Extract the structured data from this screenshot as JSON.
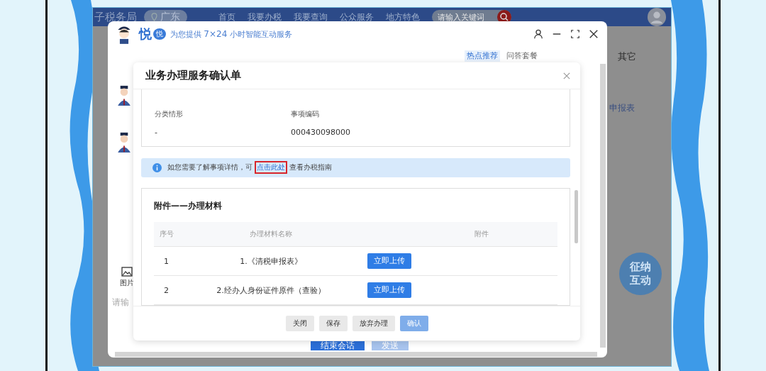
{
  "portal": {
    "site_title": "子税务局",
    "region": "广东",
    "nav": [
      {
        "label": "首页"
      },
      {
        "label": "我要办税"
      },
      {
        "label": "我要查询"
      },
      {
        "label": "公众服务"
      },
      {
        "label": "地方特色"
      }
    ],
    "search": {
      "placeholder": "请输入关键词"
    },
    "side_tab": "其它",
    "side_link": "申报表",
    "float_button": "征纳互动"
  },
  "chat_window": {
    "brand": "悦",
    "badge": "悦",
    "tagline_prefix": "为您提供 ",
    "tagline_hours": "7×24",
    "tagline_suffix": " 小时智能互动服务",
    "tabs": [
      {
        "label": "热点推荐",
        "selected": true
      },
      {
        "label": "问答套餐",
        "selected": false
      }
    ],
    "tool": "图片",
    "input": {
      "placeholder": "请输"
    },
    "buttons": [
      {
        "label": "结束会话",
        "disabled": false
      },
      {
        "label": "发送",
        "disabled": true
      }
    ]
  },
  "dialog": {
    "title": "业务办理服务确认单",
    "fields": [
      {
        "label": "分类情形",
        "value": "-"
      },
      {
        "label": "事项编码",
        "value": "000430098000"
      }
    ],
    "notice": {
      "before": "如您需要了解事项详情，可",
      "link": "点击此处",
      "after": "查看办税指南",
      "link_marked": true
    },
    "attachments": {
      "title": "附件——办理材料",
      "columns": [
        "序号",
        "办理材料名称",
        "附件"
      ],
      "rows": [
        {
          "index": "1",
          "name": "1.《清税申报表》",
          "action": "立即上传"
        },
        {
          "index": "2",
          "name": "2.经办人身份证件原件（查验）",
          "action": "立即上传"
        }
      ]
    },
    "buttons": [
      {
        "label": "关闭",
        "kind": "plain",
        "disabled": false
      },
      {
        "label": "保存",
        "kind": "plain",
        "disabled": false
      },
      {
        "label": "放弃办理",
        "kind": "plain",
        "disabled": false
      },
      {
        "label": "确认",
        "kind": "primary",
        "disabled": true
      }
    ]
  }
}
